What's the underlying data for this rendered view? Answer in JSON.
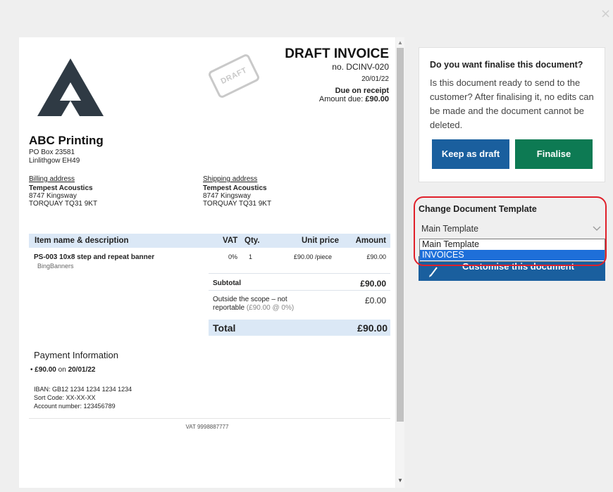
{
  "invoice": {
    "title": "DRAFT INVOICE",
    "number": "no. DCINV-020",
    "date": "20/01/22",
    "due": "Due on receipt",
    "amount_due_label": "Amount due:",
    "amount_due_value": "£90.00",
    "stamp": "DRAFT",
    "company": {
      "name": "ABC Printing",
      "line1": "PO Box 23581",
      "line2": "Linlithgow EH49"
    },
    "billing": {
      "label": "Billing address",
      "name": "Tempest Acoustics",
      "line1": "8747 Kingsway",
      "line2": "TORQUAY TQ31 9KT"
    },
    "shipping": {
      "label": "Shipping address",
      "name": "Tempest Acoustics",
      "line1": "8747 Kingsway",
      "line2": "TORQUAY TQ31 9KT"
    },
    "columns": {
      "item": "Item name & description",
      "vat": "VAT",
      "qty": "Qty.",
      "unit": "Unit price",
      "amount": "Amount"
    },
    "item": {
      "name": "PS-003 10x8 step and repeat banner",
      "sub": "BingBanners",
      "vat": "0%",
      "qty": "1",
      "unit": "£90.00 /piece",
      "amount": "£90.00"
    },
    "subtotal_label": "Subtotal",
    "subtotal_value": "£90.00",
    "oos_label": "Outside the scope – not reportable",
    "oos_detail": "(£90.00 @ 0%)",
    "oos_value": "£0.00",
    "total_label": "Total",
    "total_value": "£90.00",
    "payment": {
      "title": "Payment Information",
      "amount": "£90.00",
      "on": "on",
      "date": "20/01/22",
      "iban": "IBAN: GB12 1234 1234 1234 1234",
      "sort": "Sort Code: XX-XX-XX",
      "account": "Account number: 123456789"
    },
    "vat_reg": "VAT 9998887777"
  },
  "finalise": {
    "title": "Do you want finalise this document?",
    "body": "Is this document ready to send to the customer? After finalising it, no edits can be made and the document cannot be deleted.",
    "keep_draft": "Keep as draft",
    "finalise": "Finalise"
  },
  "template": {
    "title": "Change Document Template",
    "selected": "Main Template",
    "options": [
      "Main Template",
      "INVOICES"
    ],
    "highlighted": "INVOICES"
  },
  "customise_label": "Customise this document",
  "colors": {
    "primary_blue": "#1a5f9e",
    "finalise_green": "#0d7a53",
    "header_bg": "#dbe8f6",
    "highlight_red": "#e0202a",
    "selection_blue": "#1e6fd9"
  },
  "icons": [
    "close-icon",
    "company-logo",
    "draft-stamp",
    "chevron-down-icon",
    "pencil-icon"
  ]
}
